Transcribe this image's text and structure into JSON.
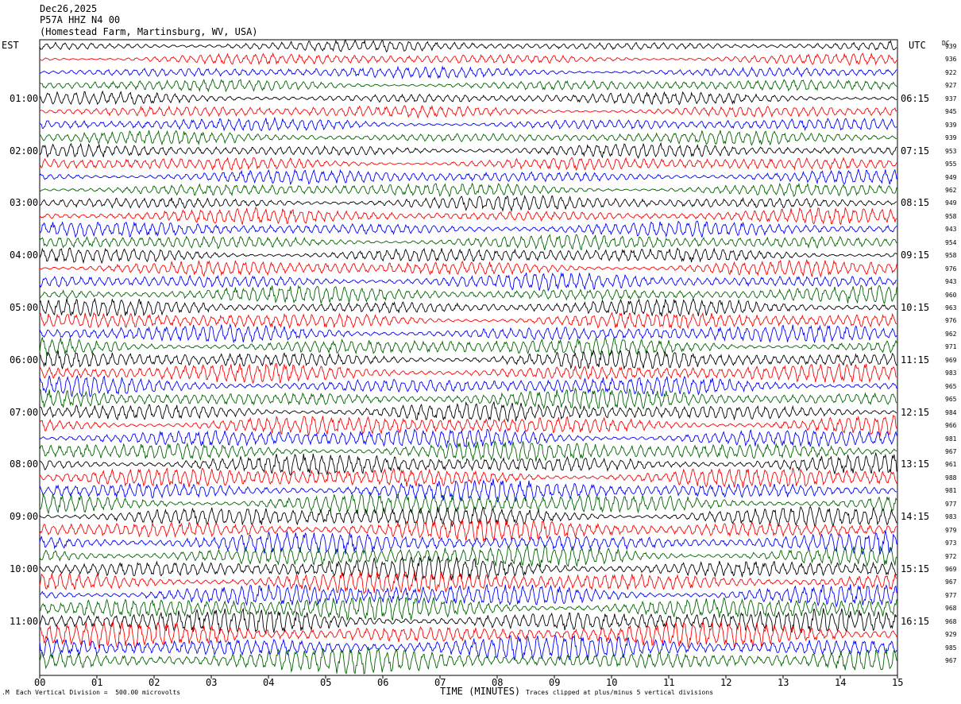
{
  "header": {
    "date": "Dec26,2025",
    "station": "P57A HHZ N4 00",
    "location": "(Homestead Farm, Martinsburg, WV, USA)"
  },
  "left_tz": "EST",
  "right_tz": "UTC",
  "dc_label": "DC",
  "footer": {
    "scale": "Each Vertical Division =  500.00 microvolts",
    "xlabel": "TIME (MINUTES)",
    "clip": "Traces clipped at plus/minus 5 vertical divisions"
  },
  "colors": [
    "#000000",
    "#ff0000",
    "#0000ff",
    "#006400"
  ],
  "chart_data": {
    "type": "line",
    "description_type": "helicorder",
    "x_ticks": [
      "00",
      "01",
      "02",
      "03",
      "04",
      "05",
      "06",
      "07",
      "08",
      "09",
      "10",
      "11",
      "12",
      "13",
      "14",
      "15"
    ],
    "xlim": [
      0,
      15
    ],
    "est_hour_labels": [
      "01:00",
      "02:00",
      "03:00",
      "04:00",
      "05:00",
      "06:00",
      "07:00",
      "08:00",
      "09:00",
      "10:00",
      "11:00"
    ],
    "utc_hour_labels": [
      "06:15",
      "07:15",
      "08:15",
      "09:15",
      "10:15",
      "11:15",
      "12:15",
      "13:15",
      "14:15",
      "15:15",
      "16:15"
    ],
    "dc_offsets": [
      939,
      936,
      922,
      927,
      937,
      945,
      939,
      939,
      953,
      955,
      949,
      962,
      949,
      958,
      943,
      954,
      958,
      976,
      943,
      960,
      963,
      976,
      962,
      971,
      969,
      983,
      965,
      965,
      984,
      966,
      981,
      967,
      961,
      988,
      981,
      977,
      983,
      979,
      973,
      972,
      969,
      967,
      977,
      968,
      968,
      929,
      985,
      967
    ],
    "trace_count": 48,
    "minutes_per_trace": 15
  }
}
